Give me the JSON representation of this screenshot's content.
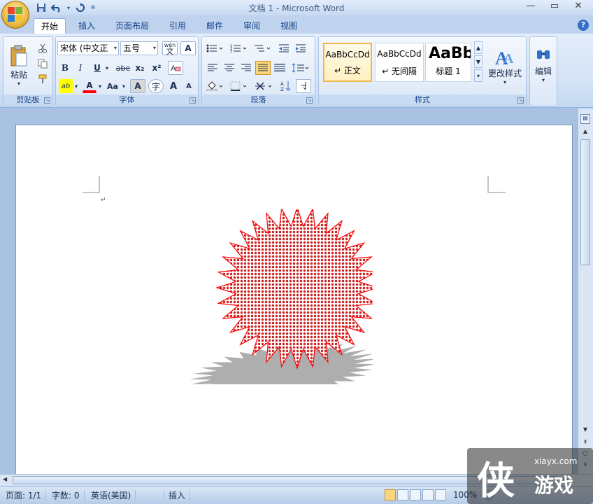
{
  "window": {
    "title": "文档 1 - Microsoft Word"
  },
  "quick_access": {
    "save_icon": "save-icon",
    "undo_icon": "undo-icon",
    "redo_icon": "redo-icon"
  },
  "tabs": [
    {
      "label": "开始",
      "active": true
    },
    {
      "label": "插入"
    },
    {
      "label": "页面布局"
    },
    {
      "label": "引用"
    },
    {
      "label": "邮件"
    },
    {
      "label": "审阅"
    },
    {
      "label": "视图"
    }
  ],
  "ribbon": {
    "clipboard": {
      "paste_label": "粘贴",
      "group_label": "剪贴板"
    },
    "font": {
      "font_name": "宋体 (中文正",
      "font_size": "五号",
      "group_label": "字体",
      "bold": "B",
      "italic": "I",
      "underline": "U",
      "strikethrough": "abe",
      "subscript": "x₂",
      "superscript": "x²",
      "grow": "A",
      "shrink": "A",
      "char_case": "Aa",
      "pinyin": "wén",
      "pinyin_char": "文",
      "char_border": "A",
      "char_shading": "A",
      "enclose": "字",
      "font_color_label": "A",
      "highlight_label": "ab"
    },
    "paragraph": {
      "group_label": "段落"
    },
    "styles": {
      "group_label": "样式",
      "cards": [
        {
          "sample": "AaBbCcDd",
          "name": "↵ 正文",
          "selected": true
        },
        {
          "sample": "AaBbCcDd",
          "name": "↵ 无间隔"
        },
        {
          "sample": "AaBb",
          "name": "标题 1"
        }
      ],
      "change_styles_label": "更改样式"
    },
    "editing": {
      "label": "编辑"
    }
  },
  "document": {
    "paragraph_mark": "↵",
    "shape": {
      "type": "starburst",
      "points": 32,
      "fill": "#ffffff",
      "pattern_color": "#cc2222",
      "outline": "#ff0000",
      "shadow_color": "#a0a0a0"
    }
  },
  "status_bar": {
    "page": "页面: 1/1",
    "words": "字数: 0",
    "language": "英语(美国)",
    "mode": "插入",
    "zoom": "100%"
  },
  "watermark": {
    "char": "侠",
    "url": "xiayx.com",
    "name": "游戏"
  },
  "colors": {
    "ribbon_bg": "#d6e4f6",
    "accent": "#15428b",
    "highlight": "#ffff00",
    "font_color": "#ff0000"
  }
}
